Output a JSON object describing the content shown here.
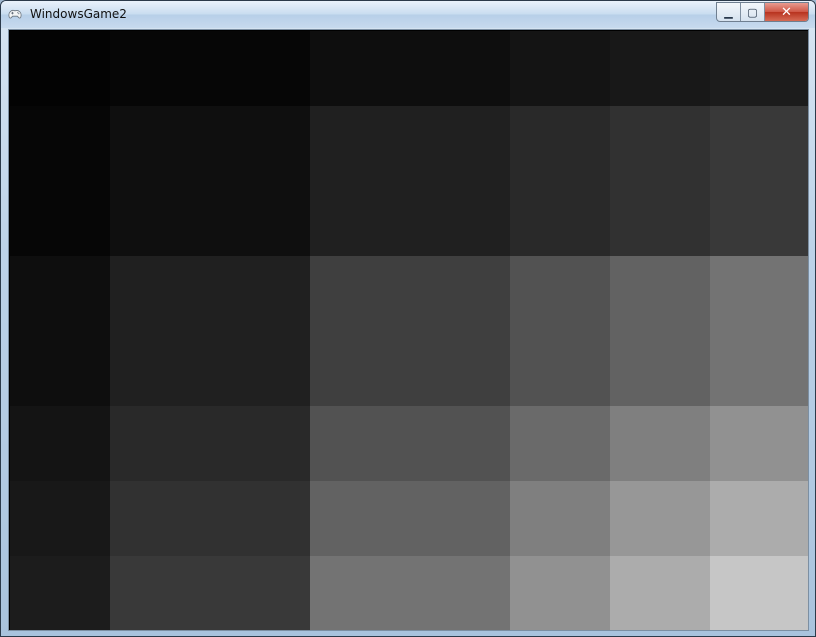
{
  "window": {
    "title": "WindowsGame2",
    "icon": "gamepad-icon",
    "controls": {
      "minimize_glyph": "▁",
      "maximize_glyph": "▢",
      "close_glyph": "✕"
    }
  },
  "game": {
    "tile_colors": [
      [
        "#030303",
        "#060606",
        "#0e0e0e",
        "#141414",
        "#181818",
        "#1c1c1c"
      ],
      [
        "#060606",
        "#0f0f0f",
        "#202020",
        "#292929",
        "#313131",
        "#393939"
      ],
      [
        "#0e0e0e",
        "#202020",
        "#3f3f3f",
        "#525252",
        "#626262",
        "#737373"
      ],
      [
        "#141414",
        "#292929",
        "#525252",
        "#6a6a6a",
        "#7f7f7f",
        "#919191"
      ],
      [
        "#181818",
        "#313131",
        "#626262",
        "#7f7f7f",
        "#979797",
        "#acacac"
      ],
      [
        "#1c1c1c",
        "#393939",
        "#737373",
        "#919191",
        "#acacac",
        "#c6c6c6"
      ]
    ]
  }
}
